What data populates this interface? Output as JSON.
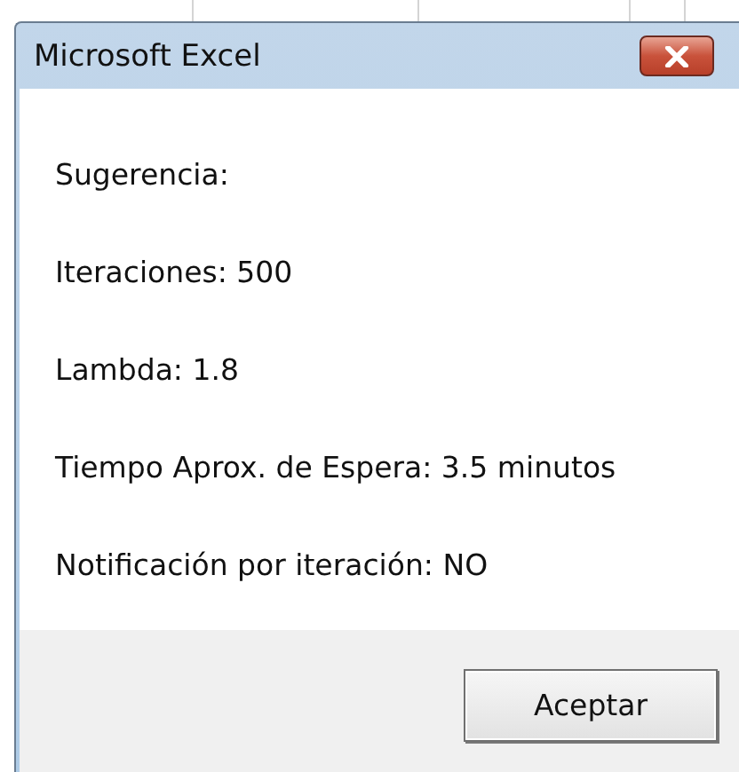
{
  "window": {
    "title": "Microsoft Excel"
  },
  "lines": [
    "Sugerencia:",
    "Iteraciones: 500",
    "Lambda: 1.8",
    "Tiempo Aprox. de Espera: 3.5 minutos",
    "Notificación por iteración: NO"
  ],
  "buttons": [
    "Aceptar"
  ]
}
